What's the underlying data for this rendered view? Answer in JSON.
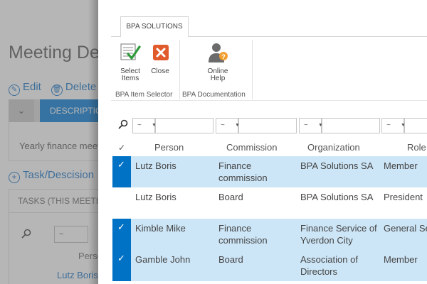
{
  "background": {
    "title": "Meeting De",
    "edit_label": "Edit",
    "delete_label": "Delete",
    "description_label": "DESCRIPTION",
    "description_text": "Yearly finance meet",
    "task_label": "Task/Descision",
    "tasks_header": "TASKS (THIS MEETING",
    "filter_value": "~",
    "person_label": "Perso",
    "first_person": "Lutz Boris"
  },
  "ribbon": {
    "tab_label": "BPA SOLUTIONS",
    "buttons": {
      "select_items": "Select Items",
      "close": "Close",
      "online_help": "Online Help"
    },
    "groups": {
      "item_selector": "BPA Item Selector",
      "documentation": "BPA Documentation"
    }
  },
  "filters": {
    "operator": "~"
  },
  "grid": {
    "columns": [
      "Person",
      "Commission",
      "Organization",
      "Role"
    ],
    "rows": [
      {
        "selected": true,
        "person": "Lutz Boris",
        "commission": "Finance commission",
        "organization": "BPA Solutions SA",
        "role": "Member"
      },
      {
        "selected": false,
        "person": "Lutz Boris",
        "commission": "Board",
        "organization": "BPA Solutions SA",
        "role": "President"
      },
      {
        "selected": true,
        "person": "Kimble Mike",
        "commission": "Finance commission",
        "organization": "Finance Service of Yverdon City",
        "role": "General Se"
      },
      {
        "selected": true,
        "person": "Gamble John",
        "commission": "Board",
        "organization": "Association of Directors",
        "role": "Member"
      }
    ]
  },
  "colors": {
    "accent": "#0072c6",
    "selected_row": "#cde6f7",
    "close_icon": "#e05a2b",
    "help_icon": "#f0a030"
  }
}
